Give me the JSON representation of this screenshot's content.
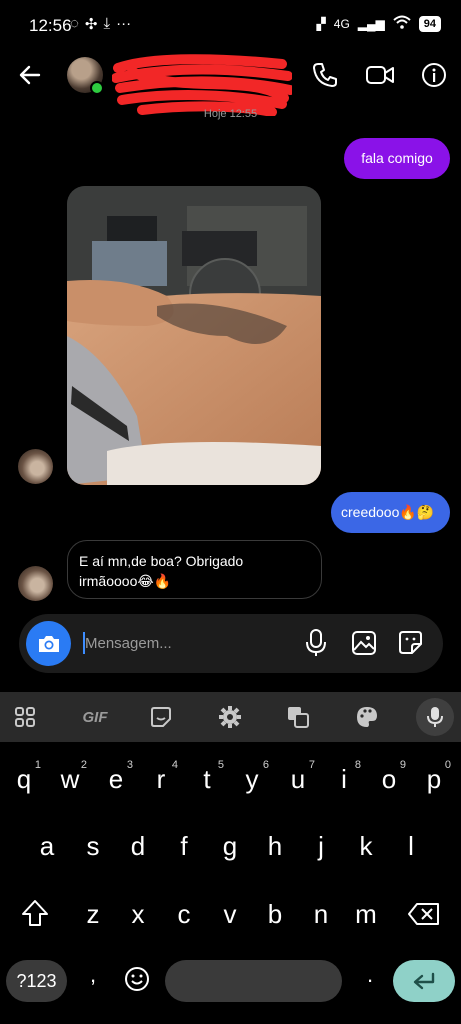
{
  "status_bar": {
    "time": "12:56",
    "network": "4G",
    "battery": "94"
  },
  "header": {
    "contact_name": ""
  },
  "day_label": "Hoje 12:55",
  "messages": {
    "m1": "fala comigo",
    "m2": "creedooo🔥🤔",
    "m3_line1": "E aí mn,de boa? Obrigado",
    "m3_line2": "irmãoooo😂🔥"
  },
  "composer": {
    "placeholder": "Mensagem..."
  },
  "keyboard": {
    "row1": [
      "q",
      "w",
      "e",
      "r",
      "t",
      "y",
      "u",
      "i",
      "o",
      "p"
    ],
    "row1_hints": [
      "1",
      "2",
      "3",
      "4",
      "5",
      "6",
      "7",
      "8",
      "9",
      "0"
    ],
    "row2": [
      "a",
      "s",
      "d",
      "f",
      "g",
      "h",
      "j",
      "k",
      "l"
    ],
    "row3": [
      "z",
      "x",
      "c",
      "v",
      "b",
      "n",
      "m"
    ],
    "symbols_key": "?123",
    "comma": ",",
    "period": ".",
    "gif_label": "GIF"
  },
  "colors": {
    "outgoing_purple": "#8a12e8",
    "outgoing_blue": "#3b67e6",
    "camera_button": "#2a7bf4",
    "enter_key": "#8fd1c8"
  }
}
